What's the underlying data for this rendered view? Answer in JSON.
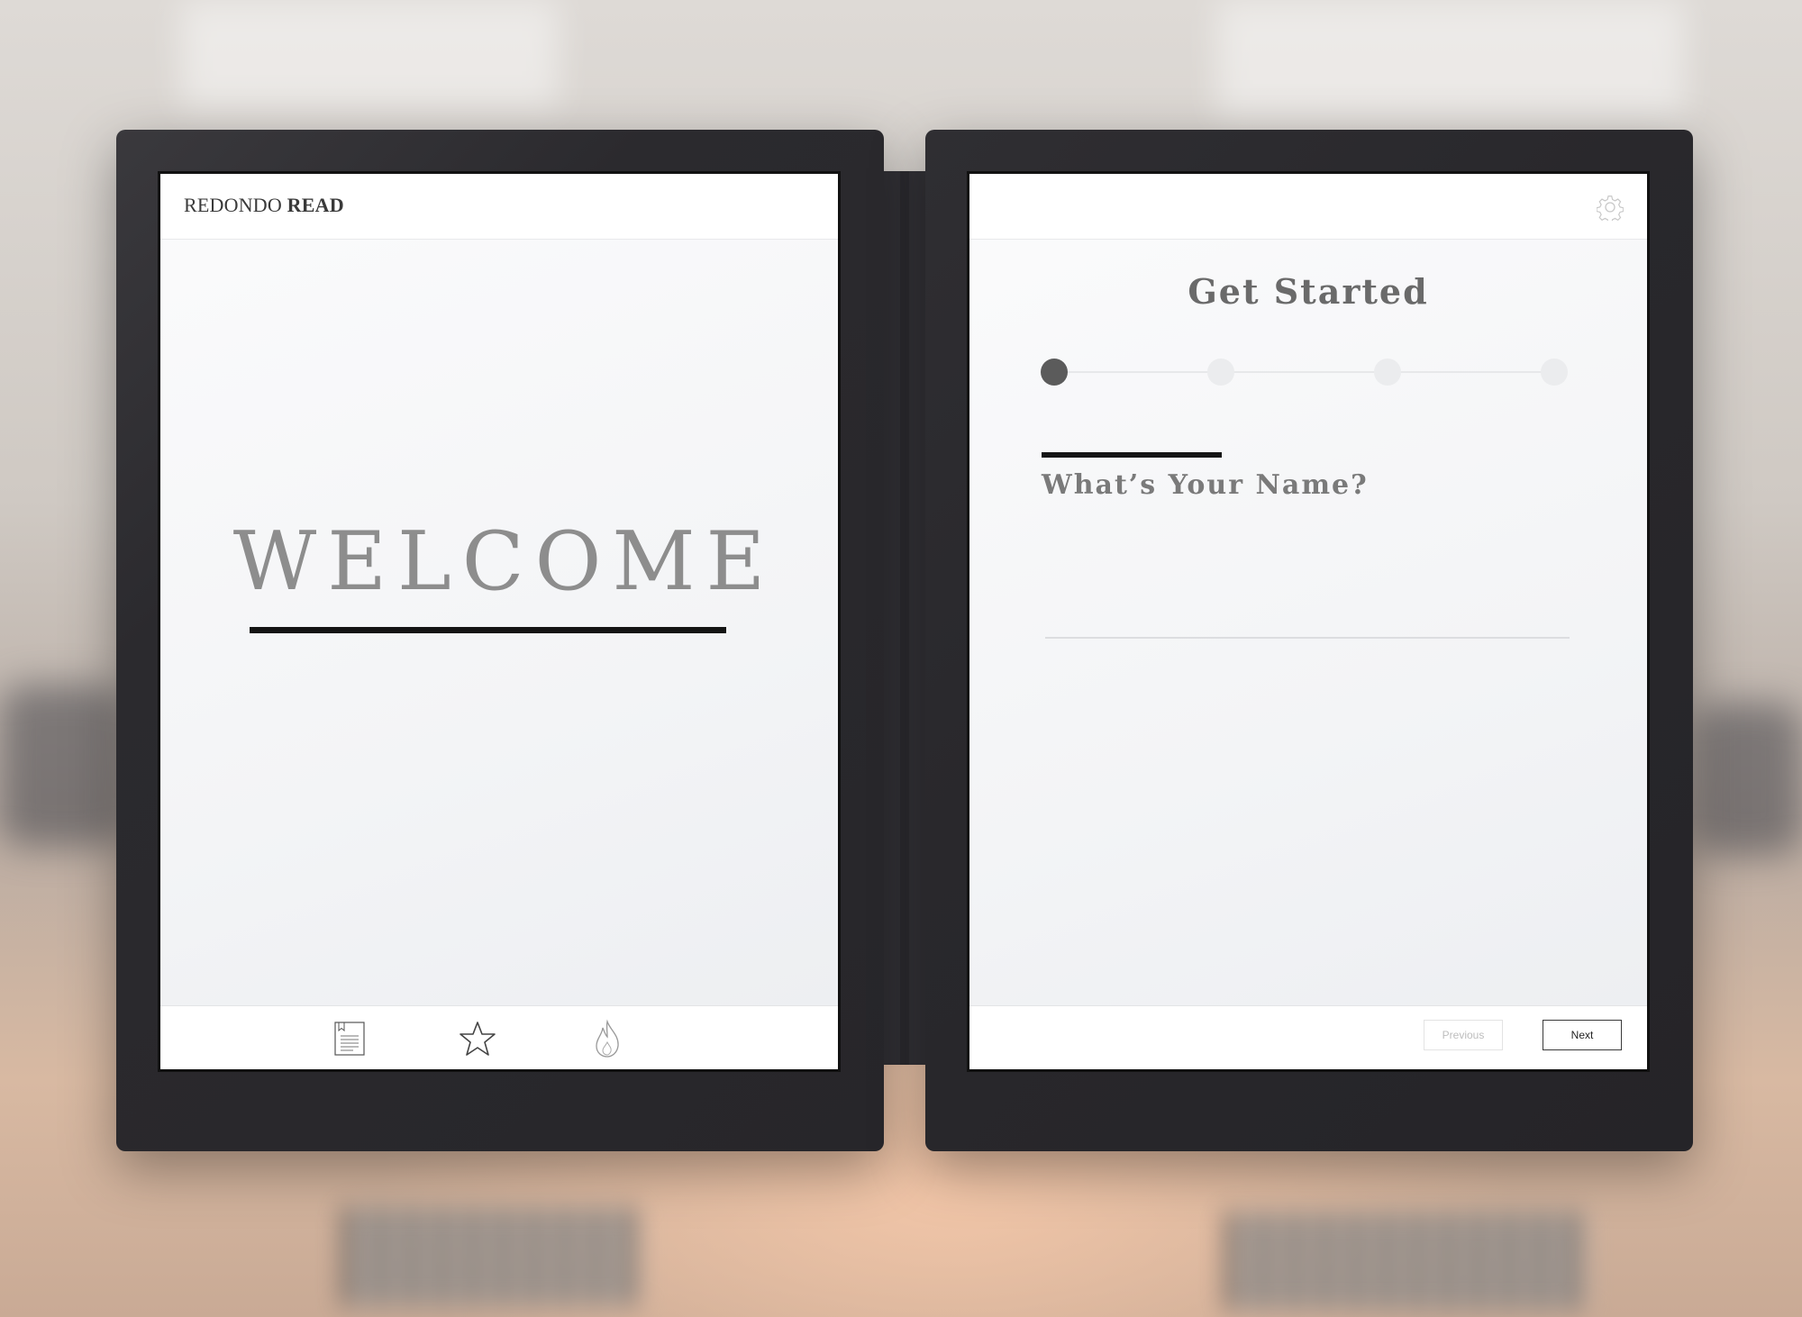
{
  "left_screen": {
    "brand_light": "REDONDO",
    "brand_bold": "READ",
    "welcome_text": "WELCOME",
    "nav": [
      {
        "icon": "document-icon"
      },
      {
        "icon": "star-icon"
      },
      {
        "icon": "flame-icon"
      }
    ]
  },
  "right_screen": {
    "settings_icon": "gear-icon",
    "title": "Get Started",
    "steps": {
      "total": 4,
      "current": 1
    },
    "question": "What’s Your Name?",
    "name_value": "",
    "previous_label": "Previous",
    "next_label": "Next"
  },
  "colors": {
    "device_bezel": "#28272b",
    "accent_rule": "#141414",
    "active_step": "#5b5b5b",
    "inactive_step": "#ebecee"
  }
}
